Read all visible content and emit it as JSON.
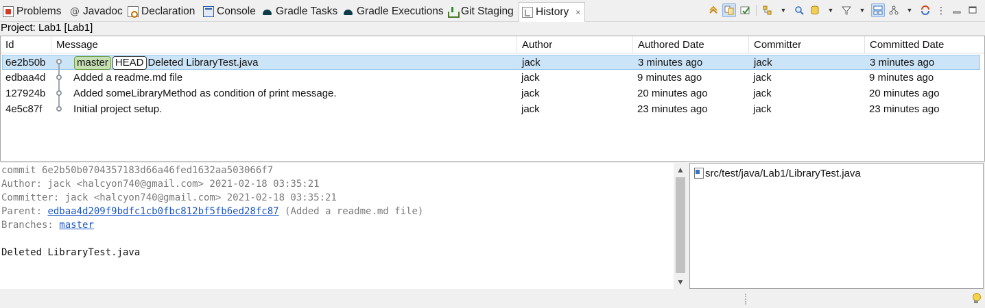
{
  "tabs": [
    {
      "label": "Problems",
      "icon": "problems-icon"
    },
    {
      "label": "Javadoc",
      "icon": "javadoc-icon"
    },
    {
      "label": "Declaration",
      "icon": "declaration-icon"
    },
    {
      "label": "Console",
      "icon": "console-icon"
    },
    {
      "label": "Gradle Tasks",
      "icon": "gradle-icon"
    },
    {
      "label": "Gradle Executions",
      "icon": "gradle-icon"
    },
    {
      "label": "Git Staging",
      "icon": "git-staging-icon"
    },
    {
      "label": "History",
      "icon": "history-icon",
      "active": true,
      "close": "×"
    }
  ],
  "project_label": "Project: Lab1 [Lab1]",
  "table": {
    "headers": {
      "id": "Id",
      "message": "Message",
      "author": "Author",
      "authored_date": "Authored Date",
      "committer": "Committer",
      "committed_date": "Committed Date"
    },
    "rows": [
      {
        "id": "6e2b50b",
        "refs": [
          "master",
          "HEAD"
        ],
        "message": "Deleted LibraryTest.java",
        "author": "jack",
        "authored": "3 minutes ago",
        "committer": "jack",
        "committed": "3 minutes ago",
        "selected": true
      },
      {
        "id": "edbaa4d",
        "message": "Added a readme.md file",
        "author": "jack",
        "authored": "9 minutes ago",
        "committer": "jack",
        "committed": "9 minutes ago"
      },
      {
        "id": "127924b",
        "message": "Added someLibraryMethod as condition of print message.",
        "author": "jack",
        "authored": "20 minutes ago",
        "committer": "jack",
        "committed": "20 minutes ago"
      },
      {
        "id": "4e5c87f",
        "message": "Initial project setup.",
        "author": "jack",
        "authored": "23 minutes ago",
        "committer": "jack",
        "committed": "23 minutes ago"
      }
    ]
  },
  "details": {
    "commit_line": "commit 6e2b50b0704357183d66a46fed1632aa503066f7",
    "author_line": "Author: jack <halcyon740@gmail.com> 2021-02-18 03:35:21",
    "committer_line": "Committer: jack <halcyon740@gmail.com> 2021-02-18 03:35:21",
    "parent_prefix": "Parent: ",
    "parent_hash": "edbaa4d209f9bdfc1cb0fbc812bf5fb6ed28fc87",
    "parent_suffix": " (Added a readme.md file)",
    "branches_prefix": "Branches: ",
    "branches_link": "master",
    "message": "Deleted LibraryTest.java"
  },
  "files": [
    "src/test/java/Lab1/LibraryTest.java"
  ],
  "colors": {
    "selection": "#cce4f7",
    "master_ref": "#c6e0b4",
    "link": "#1a55c6"
  }
}
